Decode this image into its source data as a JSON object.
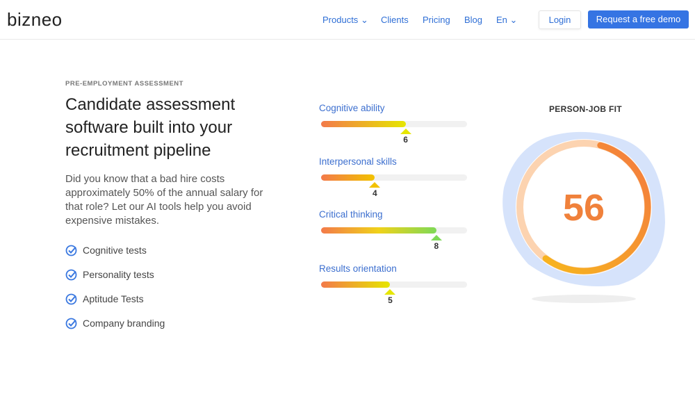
{
  "nav": {
    "logo": "bizneo",
    "items": [
      {
        "label": "Products",
        "dropdown": true
      },
      {
        "label": "Clients"
      },
      {
        "label": "Pricing"
      },
      {
        "label": "Blog"
      },
      {
        "label": "En",
        "dropdown": true
      }
    ],
    "login": "Login",
    "demo": "Request a free demo"
  },
  "hero": {
    "eyebrow": "PRE-EMPLOYMENT ASSESSMENT",
    "title": "Candidate assessment software built into your recruitment pipeline",
    "description": "Did you know that a bad hire costs approximately 50% of the annual salary for that role? Let our AI tools help you avoid expensive mistakes.",
    "checks": [
      "Cognitive tests",
      "Personality tests",
      "Aptitude Tests",
      "Company branding"
    ]
  },
  "skills": [
    {
      "label": "Cognitive ability",
      "value": "6",
      "color": "#e6e600"
    },
    {
      "label": "Interpersonal skills",
      "value": "4",
      "color": "#f2c200"
    },
    {
      "label": "Critical thinking",
      "value": "8",
      "color": "#7ed957"
    },
    {
      "label": "Results orientation",
      "value": "5",
      "color": "#e6e600"
    }
  ],
  "fit": {
    "title": "PERSON-JOB FIT",
    "score": "56",
    "colors": {
      "accent": "#f0813b",
      "blob": "#d6e3fb",
      "ring": "#fcd3b0"
    }
  }
}
